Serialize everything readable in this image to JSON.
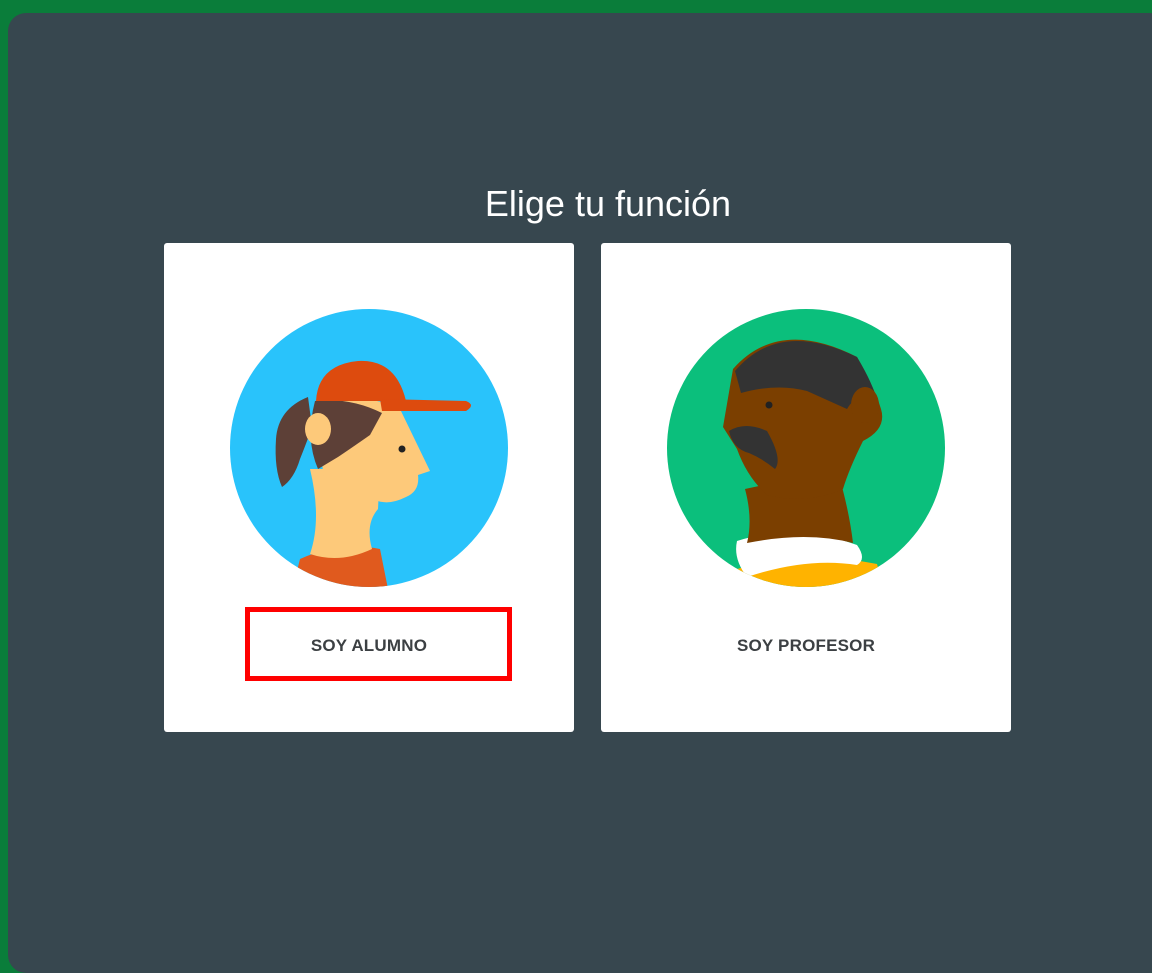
{
  "dialog": {
    "title": "Elige tu función"
  },
  "roles": [
    {
      "label": "SOY ALUMNO",
      "avatar_icon": "student-avatar-icon",
      "avatar_bg": "#29c3fb"
    },
    {
      "label": "SOY PROFESOR",
      "avatar_icon": "teacher-avatar-icon",
      "avatar_bg": "#0bbf7c"
    }
  ],
  "colors": {
    "frame": "#0a7d3a",
    "panel": "#37474f",
    "card": "#ffffff",
    "highlight": "#ff0000"
  }
}
